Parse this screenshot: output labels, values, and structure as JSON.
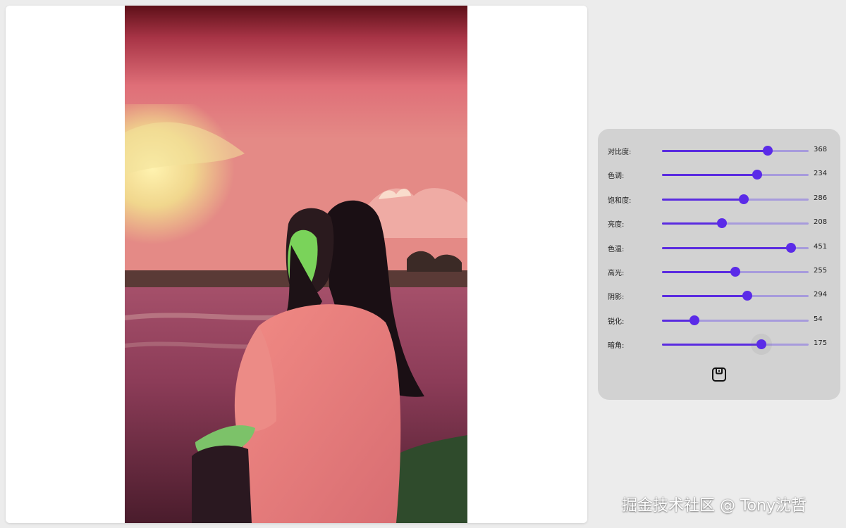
{
  "image": {
    "description": "Edited portrait photo: woman with long dark hair by the sea at sunset, strong pink/green color cast"
  },
  "adjustments": [
    {
      "label": "对比度:",
      "value": 368,
      "fraction": 0.72,
      "name": "contrast"
    },
    {
      "label": "色调:",
      "value": 234,
      "fraction": 0.65,
      "name": "tint"
    },
    {
      "label": "饱和度:",
      "value": 286,
      "fraction": 0.56,
      "name": "saturation"
    },
    {
      "label": "亮度:",
      "value": 208,
      "fraction": 0.41,
      "name": "brightness"
    },
    {
      "label": "色温:",
      "value": 451,
      "fraction": 0.88,
      "name": "temperature"
    },
    {
      "label": "高光:",
      "value": 255,
      "fraction": 0.5,
      "name": "highlights"
    },
    {
      "label": "阴影:",
      "value": 294,
      "fraction": 0.58,
      "name": "shadows"
    },
    {
      "label": "锐化:",
      "value": 54,
      "fraction": 0.22,
      "name": "sharpen"
    },
    {
      "label": "暗角:",
      "value": 175,
      "fraction": 0.68,
      "name": "vignette"
    }
  ],
  "save_button": {
    "icon": "save-icon"
  },
  "watermark": "掘金技术社区 @ Tony沈哲",
  "colors": {
    "accent": "#5b2be8",
    "track": "#a79bdc",
    "panel": "#d2d2d2",
    "background": "#ececec"
  }
}
